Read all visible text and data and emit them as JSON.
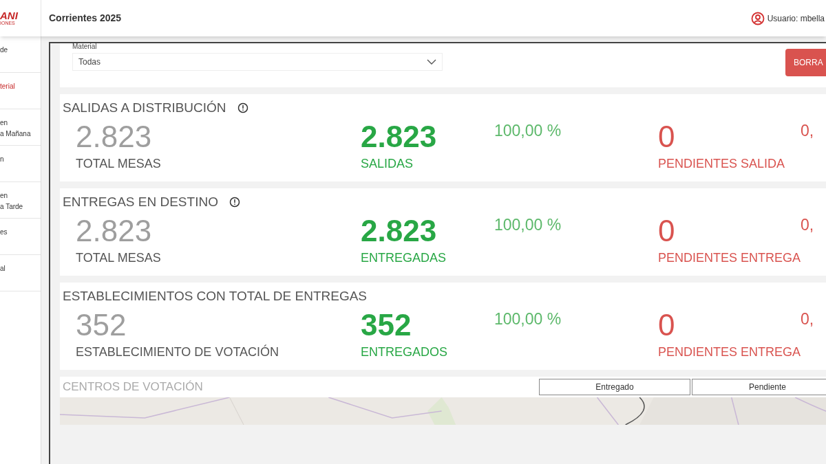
{
  "logo": {
    "name": "ANI",
    "tagline": "IONES"
  },
  "header": {
    "title": "Corrientes 2025",
    "user": "Usuario: mbella"
  },
  "sidebar": {
    "items": [
      {
        "lines": [
          "de"
        ],
        "selected": false
      },
      {
        "lines": [
          "terial"
        ],
        "selected": true
      },
      {
        "lines": [
          "en",
          "a Mañana"
        ],
        "selected": false
      },
      {
        "lines": [
          "n"
        ],
        "selected": false
      },
      {
        "lines": [
          "en",
          "a Tarde"
        ],
        "selected": false
      },
      {
        "lines": [
          "es"
        ],
        "selected": false
      },
      {
        "lines": [
          "al"
        ],
        "selected": false
      }
    ]
  },
  "filter": {
    "label": "Material",
    "value": "Todas",
    "button": "BORRA"
  },
  "sections": [
    {
      "title": "SALIDAS A DISTRIBUCIÓN",
      "info": true,
      "total": "2.823",
      "total_label": "TOTAL MESAS",
      "done": "2.823",
      "done_label": "SALIDAS",
      "percent": "100,00 %",
      "pending": "0",
      "pending_label": "PENDIENTES SALIDA",
      "pending_percent": "0,"
    },
    {
      "title": "ENTREGAS EN DESTINO",
      "info": true,
      "total": "2.823",
      "total_label": "TOTAL MESAS",
      "done": "2.823",
      "done_label": "ENTREGADAS",
      "percent": "100,00 %",
      "pending": "0",
      "pending_label": "PENDIENTES ENTREGA",
      "pending_percent": "0,"
    },
    {
      "title": "ESTABLECIMIENTOS CON TOTAL DE ENTREGAS",
      "info": false,
      "total": "352",
      "total_label": "ESTABLECIMIENTO DE VOTACIÓN",
      "done": "352",
      "done_label": "ENTREGADOS",
      "percent": "100,00 %",
      "pending": "0",
      "pending_label": "PENDIENTES ENTREGA",
      "pending_percent": "0,"
    }
  ],
  "map": {
    "title": "CENTROS DE VOTACIÓN",
    "legend": [
      "Entregado",
      "Pendiente"
    ],
    "kind": "picture"
  }
}
